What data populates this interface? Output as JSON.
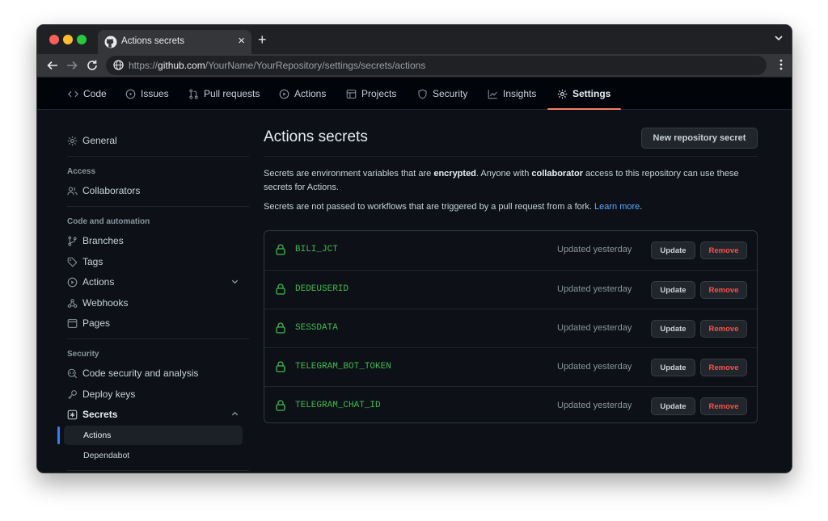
{
  "browser": {
    "tab_title": "Actions secrets",
    "url_prefix": "https://",
    "url_host": "github.com",
    "url_path": "/YourName/YourRepository/settings/secrets/actions"
  },
  "repo_nav": [
    {
      "label": "Code",
      "icon": "code-icon"
    },
    {
      "label": "Issues",
      "icon": "issue-icon"
    },
    {
      "label": "Pull requests",
      "icon": "pull-request-icon"
    },
    {
      "label": "Actions",
      "icon": "play-icon"
    },
    {
      "label": "Projects",
      "icon": "table-icon"
    },
    {
      "label": "Security",
      "icon": "shield-icon"
    },
    {
      "label": "Insights",
      "icon": "graph-icon"
    },
    {
      "label": "Settings",
      "icon": "gear-icon",
      "active": true
    }
  ],
  "sidebar": {
    "general": "General",
    "access_heading": "Access",
    "collaborators": "Collaborators",
    "automation_heading": "Code and automation",
    "branches": "Branches",
    "tags": "Tags",
    "actions": "Actions",
    "webhooks": "Webhooks",
    "pages": "Pages",
    "security_heading": "Security",
    "code_security": "Code security and analysis",
    "deploy_keys": "Deploy keys",
    "secrets": "Secrets",
    "secrets_sub": [
      "Actions",
      "Dependabot"
    ]
  },
  "main": {
    "title": "Actions secrets",
    "new_button": "New repository secret",
    "desc1": {
      "p1": "Secrets are environment variables that are ",
      "b1": "encrypted",
      "p2": ". Anyone with ",
      "b2": "collaborator",
      "p3": " access to this repository can use these secrets for Actions."
    },
    "desc2": {
      "p1": "Secrets are not passed to workflows that are triggered by a pull request from a fork. ",
      "link": "Learn more",
      "p2": "."
    },
    "secrets": [
      {
        "name": "BILI_JCT",
        "updated": "Updated yesterday"
      },
      {
        "name": "DEDEUSERID",
        "updated": "Updated yesterday"
      },
      {
        "name": "SESSDATA",
        "updated": "Updated yesterday"
      },
      {
        "name": "TELEGRAM_BOT_TOKEN",
        "updated": "Updated yesterday"
      },
      {
        "name": "TELEGRAM_CHAT_ID",
        "updated": "Updated yesterday"
      }
    ],
    "update_label": "Update",
    "remove_label": "Remove"
  },
  "colors": {
    "accent_underline": "#f78166",
    "secret_name": "#3fb950",
    "danger": "#f85149",
    "link": "#58a6ff"
  }
}
